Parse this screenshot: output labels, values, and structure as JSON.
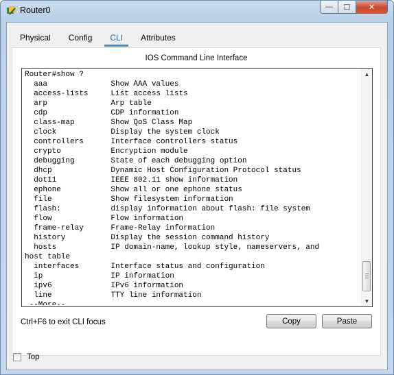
{
  "window": {
    "title": "Router0",
    "min_glyph": "—",
    "max_glyph": "☐",
    "close_glyph": "✕"
  },
  "tabs": [
    {
      "label": "Physical",
      "active": false
    },
    {
      "label": "Config",
      "active": false
    },
    {
      "label": "CLI",
      "active": true
    },
    {
      "label": "Attributes",
      "active": false
    }
  ],
  "cli": {
    "heading": "IOS Command Line Interface",
    "lines": [
      "Router#show ?",
      "  aaa              Show AAA values",
      "  access-lists     List access lists",
      "  arp              Arp table",
      "  cdp              CDP information",
      "  class-map        Show QoS Class Map",
      "  clock            Display the system clock",
      "  controllers      Interface controllers status",
      "  crypto           Encryption module",
      "  debugging        State of each debugging option",
      "  dhcp             Dynamic Host Configuration Protocol status",
      "  dot11            IEEE 802.11 show information",
      "  ephone           Show all or one ephone status",
      "  file             Show filesystem information",
      "  flash:           display information about flash: file system",
      "  flow             Flow information",
      "  frame-relay      Frame-Relay information",
      "  history          Display the session command history",
      "  hosts            IP domain-name, lookup style, nameservers, and",
      "host table",
      "  interfaces       Interface status and configuration",
      "  ip               IP information",
      "  ipv6             IPv6 information",
      "  line             TTY line information",
      " --More-- "
    ]
  },
  "footer": {
    "hint": "Ctrl+F6 to exit CLI focus",
    "copy_label": "Copy",
    "paste_label": "Paste"
  },
  "bottom": {
    "top_label": "Top",
    "top_checked": false
  }
}
